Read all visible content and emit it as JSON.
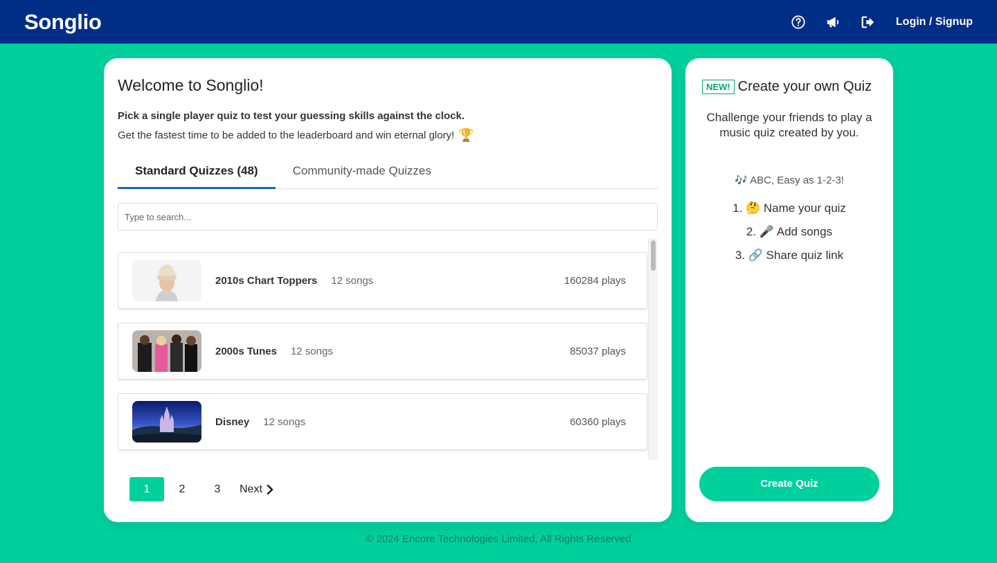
{
  "header": {
    "logo": "Songlio",
    "icons": [
      "help-circle-icon",
      "megaphone-icon",
      "logout-icon"
    ],
    "login_label": "Login / Signup"
  },
  "main": {
    "title": "Welcome to Songlio!",
    "intro_line1": "Pick a single player quiz to test your guessing skills against the clock.",
    "intro_line2": "Get the fastest time to be added to the leaderboard and win eternal glory!",
    "intro_emoji": "🏆",
    "tabs": [
      {
        "label": "Standard Quizzes (48)",
        "active": true
      },
      {
        "label": "Community-made Quizzes",
        "active": false
      }
    ],
    "search": {
      "placeholder": "Type to search...",
      "value": ""
    },
    "quizzes": [
      {
        "name": "2010s Chart Toppers",
        "songs": "12 songs",
        "plays": "160284 plays",
        "thumb": "person-beanie"
      },
      {
        "name": "2000s Tunes",
        "songs": "12 songs",
        "plays": "85037 plays",
        "thumb": "group-photo"
      },
      {
        "name": "Disney",
        "songs": "12 songs",
        "plays": "60360 plays",
        "thumb": "castle"
      }
    ],
    "pagination": {
      "pages": [
        "1",
        "2",
        "3"
      ],
      "current": "1",
      "next_label": "Next"
    }
  },
  "side": {
    "badge": "NEW!",
    "title": "Create your own Quiz",
    "description": "Challenge your friends to play a music quiz created by you.",
    "easy_line": "🎶 ABC, Easy as 1-2-3!",
    "steps": [
      "1. 🤔 Name your quiz",
      "2. 🎤 Add songs",
      "3. 🔗 Share quiz link"
    ],
    "cta_label": "Create Quiz"
  },
  "footer": {
    "text": "© 2024 Encore Technologies Limited, All Rights Reserved"
  },
  "colors": {
    "header": "#002d86",
    "accent": "#00d09c",
    "tab_underline": "#1565c0",
    "badge": "#00a870"
  }
}
